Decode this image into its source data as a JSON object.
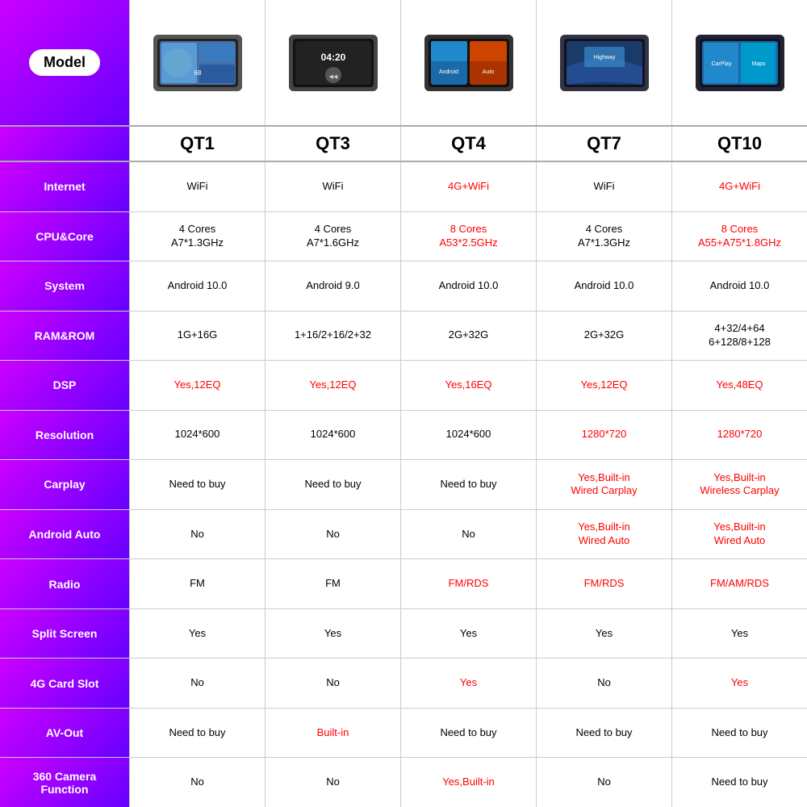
{
  "header": {
    "model_label": "Model"
  },
  "models": [
    "QT1",
    "QT3",
    "QT4",
    "QT7",
    "QT10"
  ],
  "rows": [
    {
      "label": "Internet",
      "cells": [
        {
          "text": "WiFi",
          "red": false
        },
        {
          "text": "WiFi",
          "red": false
        },
        {
          "text": "4G+WiFi",
          "red": true
        },
        {
          "text": "WiFi",
          "red": false
        },
        {
          "text": "4G+WiFi",
          "red": true
        }
      ]
    },
    {
      "label": "CPU&Core",
      "cells": [
        {
          "text": "4 Cores\nA7*1.3GHz",
          "red": false
        },
        {
          "text": "4 Cores\nA7*1.6GHz",
          "red": false
        },
        {
          "text": "8 Cores\nA53*2.5GHz",
          "red": true
        },
        {
          "text": "4 Cores\nA7*1.3GHz",
          "red": false
        },
        {
          "text": "8 Cores\nA55+A75*1.8GHz",
          "red": true
        }
      ]
    },
    {
      "label": "System",
      "cells": [
        {
          "text": "Android 10.0",
          "red": false
        },
        {
          "text": "Android 9.0",
          "red": false
        },
        {
          "text": "Android 10.0",
          "red": false
        },
        {
          "text": "Android 10.0",
          "red": false
        },
        {
          "text": "Android 10.0",
          "red": false
        }
      ]
    },
    {
      "label": "RAM&ROM",
      "cells": [
        {
          "text": "1G+16G",
          "red": false
        },
        {
          "text": "1+16/2+16/2+32",
          "red": false
        },
        {
          "text": "2G+32G",
          "red": false
        },
        {
          "text": "2G+32G",
          "red": false
        },
        {
          "text": "4+32/4+64\n6+128/8+128",
          "red": false
        }
      ]
    },
    {
      "label": "DSP",
      "cells": [
        {
          "text": "Yes,12EQ",
          "red": true
        },
        {
          "text": "Yes,12EQ",
          "red": true
        },
        {
          "text": "Yes,16EQ",
          "red": true
        },
        {
          "text": "Yes,12EQ",
          "red": true
        },
        {
          "text": "Yes,48EQ",
          "red": true
        }
      ]
    },
    {
      "label": "Resolution",
      "cells": [
        {
          "text": "1024*600",
          "red": false
        },
        {
          "text": "1024*600",
          "red": false
        },
        {
          "text": "1024*600",
          "red": false
        },
        {
          "text": "1280*720",
          "red": true
        },
        {
          "text": "1280*720",
          "red": true
        }
      ]
    },
    {
      "label": "Carplay",
      "cells": [
        {
          "text": "Need to buy",
          "red": false
        },
        {
          "text": "Need to buy",
          "red": false
        },
        {
          "text": "Need to buy",
          "red": false
        },
        {
          "text": "Yes,Built-in\nWired Carplay",
          "red": true
        },
        {
          "text": "Yes,Built-in\nWireless Carplay",
          "red": true
        }
      ]
    },
    {
      "label": "Android Auto",
      "cells": [
        {
          "text": "No",
          "red": false
        },
        {
          "text": "No",
          "red": false
        },
        {
          "text": "No",
          "red": false
        },
        {
          "text": "Yes,Built-in\nWired Auto",
          "red": true
        },
        {
          "text": "Yes,Built-in\nWired Auto",
          "red": true
        }
      ]
    },
    {
      "label": "Radio",
      "cells": [
        {
          "text": "FM",
          "red": false
        },
        {
          "text": "FM",
          "red": false
        },
        {
          "text": "FM/RDS",
          "red": true
        },
        {
          "text": "FM/RDS",
          "red": true
        },
        {
          "text": "FM/AM/RDS",
          "red": true
        }
      ]
    },
    {
      "label": "Split Screen",
      "cells": [
        {
          "text": "Yes",
          "red": false
        },
        {
          "text": "Yes",
          "red": false
        },
        {
          "text": "Yes",
          "red": false
        },
        {
          "text": "Yes",
          "red": false
        },
        {
          "text": "Yes",
          "red": false
        }
      ]
    },
    {
      "label": "4G Card Slot",
      "cells": [
        {
          "text": "No",
          "red": false
        },
        {
          "text": "No",
          "red": false
        },
        {
          "text": "Yes",
          "red": true
        },
        {
          "text": "No",
          "red": false
        },
        {
          "text": "Yes",
          "red": true
        }
      ]
    },
    {
      "label": "AV-Out",
      "cells": [
        {
          "text": "Need to buy",
          "red": false
        },
        {
          "text": "Built-in",
          "red": true
        },
        {
          "text": "Need to buy",
          "red": false
        },
        {
          "text": "Need to buy",
          "red": false
        },
        {
          "text": "Need to buy",
          "red": false
        }
      ]
    },
    {
      "label": "360 Camera\nFunction",
      "cells": [
        {
          "text": "No",
          "red": false
        },
        {
          "text": "No",
          "red": false
        },
        {
          "text": "Yes,Built-in",
          "red": true
        },
        {
          "text": "No",
          "red": false
        },
        {
          "text": "Need to buy",
          "red": false
        }
      ]
    }
  ]
}
